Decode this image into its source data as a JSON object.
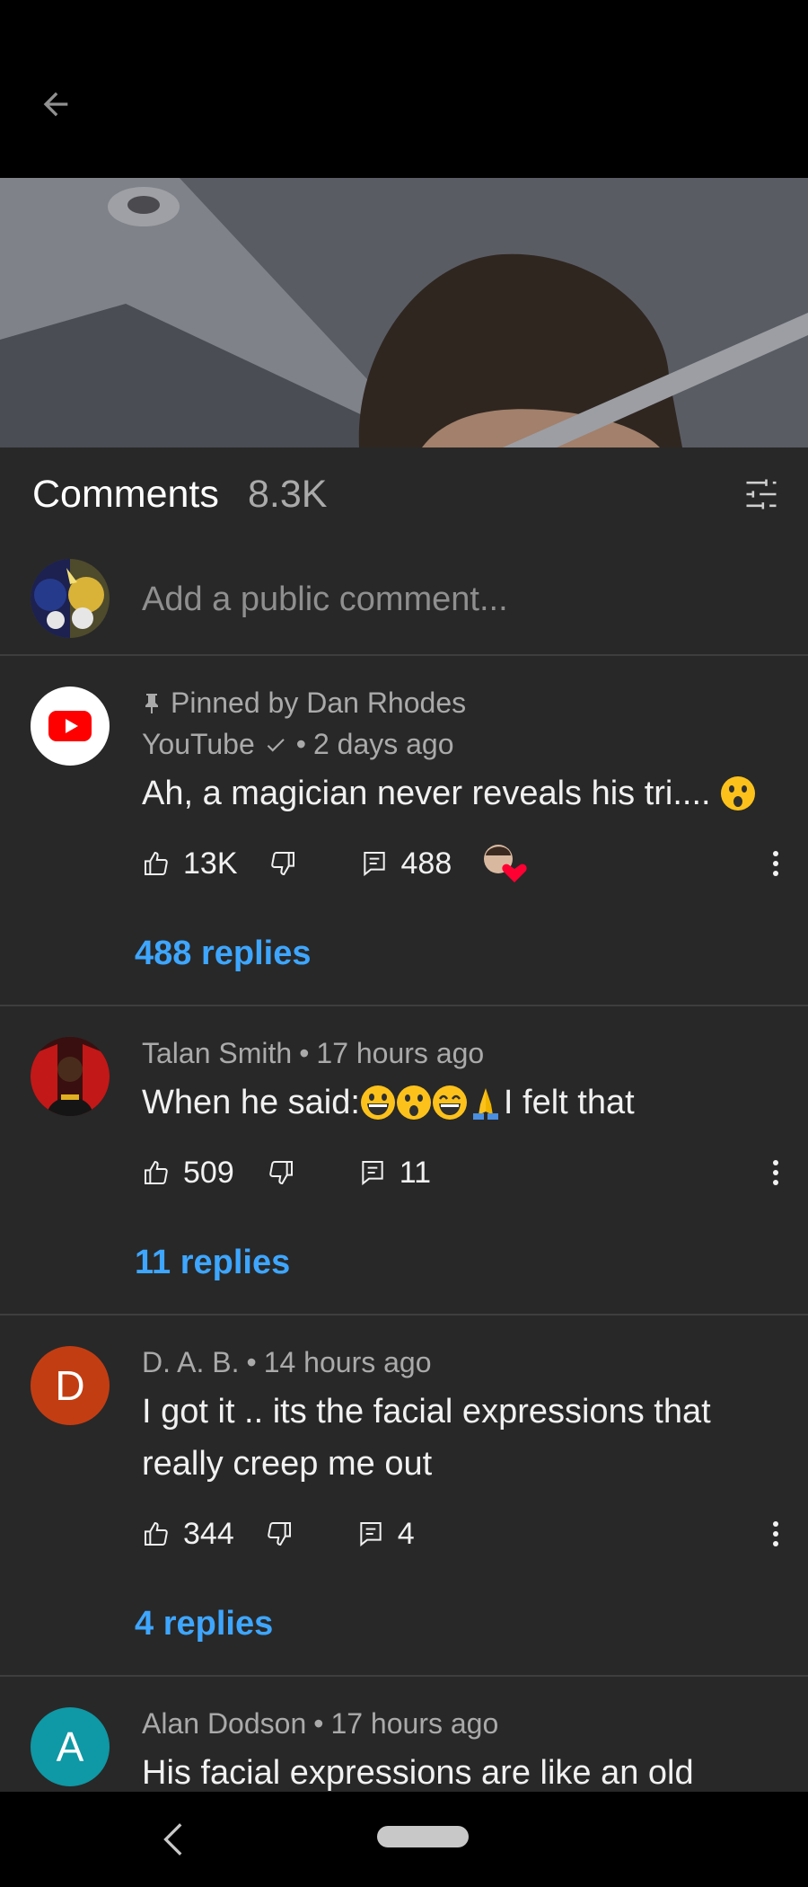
{
  "header": {
    "title": "Comments",
    "count": "8.3K"
  },
  "add_comment": {
    "placeholder": "Add a public comment..."
  },
  "comments": [
    {
      "pinned_label": "Pinned by Dan Rhodes",
      "author": "YouTube",
      "time": "2 days ago",
      "text": "Ah, a magician never reveals his tri....",
      "likes": "13K",
      "reply_count": "488",
      "replies_label": "488 replies"
    },
    {
      "author": "Talan Smith",
      "time": "17 hours ago",
      "text_before": "When he said:",
      "text_after": "I felt that",
      "likes": "509",
      "reply_count": "11",
      "replies_label": "11 replies"
    },
    {
      "author": "D. A. B.",
      "avatar_letter": "D",
      "time": "14 hours ago",
      "text": "I got it .. its the facial expressions that really creep me out",
      "likes": "344",
      "reply_count": "4",
      "replies_label": "4 replies"
    },
    {
      "author": "Alan Dodson",
      "avatar_letter": "A",
      "time": "17 hours ago",
      "text": "His facial expressions are like an old"
    }
  ],
  "separator": "•",
  "colors": {
    "link": "#3ea6ff",
    "youtube_red": "#ff0000",
    "avatar_d": "#c33d12",
    "avatar_a": "#0f98a5"
  }
}
